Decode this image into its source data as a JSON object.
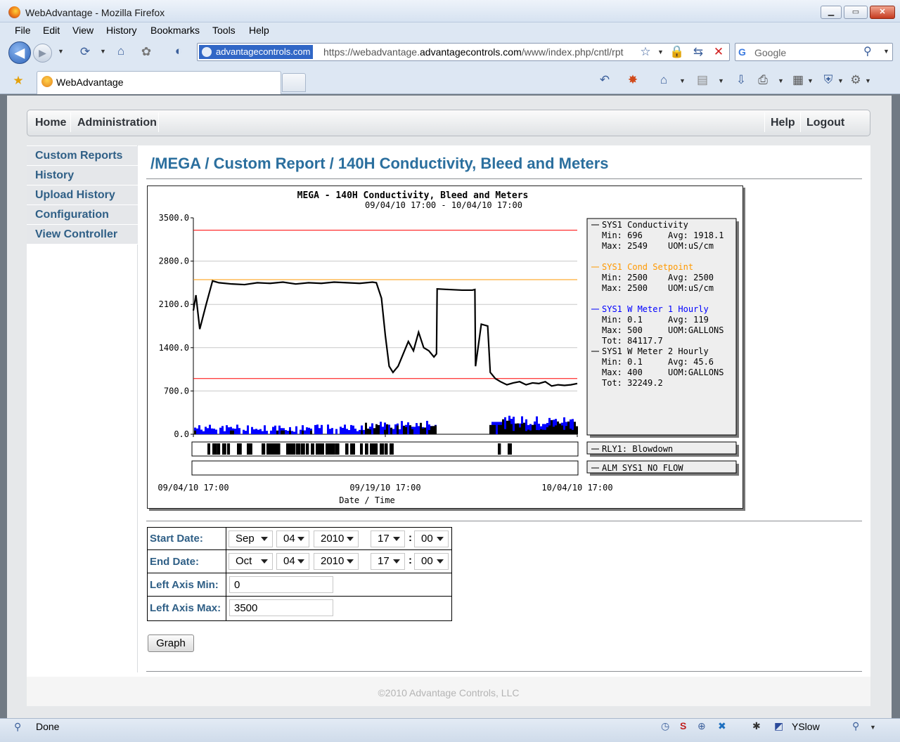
{
  "browser": {
    "title": "WebAdvantage - Mozilla Firefox",
    "menu": [
      "File",
      "Edit",
      "View",
      "History",
      "Bookmarks",
      "Tools",
      "Help"
    ],
    "url_site": "advantagecontrols.com",
    "url_prefix": "https://webadvantage.",
    "url_domain": "advantagecontrols.com",
    "url_path": "/www/index.php/cntl/rpt",
    "search_placeholder": "Google",
    "tab_label": "WebAdvantage",
    "status": "Done",
    "yslow": "YSlow"
  },
  "topnav": {
    "home": "Home",
    "admin": "Administration",
    "help": "Help",
    "logout": "Logout"
  },
  "sidebar": [
    "Custom Reports",
    "History",
    "Upload History",
    "Configuration",
    "View Controller"
  ],
  "page_title": "/MEGA / Custom Report / 140H Conductivity, Bleed and Meters",
  "chart_data": {
    "type": "line",
    "title": "MEGA - 140H Conductivity, Bleed and Meters",
    "subtitle": "09/04/10 17:00 - 10/04/10 17:00",
    "xlabel": "Date / Time",
    "x_ticks": [
      "09/04/10 17:00",
      "09/19/10 17:00",
      "10/04/10 17:00"
    ],
    "ylim": [
      0,
      3500
    ],
    "y_ticks": [
      "3500.0",
      "2800.0",
      "2100.0",
      "1400.0",
      "700.0",
      "0.0"
    ],
    "limit_lines": [
      3300,
      900
    ],
    "grid": true,
    "legend_position": "right",
    "series": [
      {
        "name": "SYS1 Conductivity",
        "color": "#000000",
        "x": [
          0,
          0.2,
          0.5,
          1,
          1.5,
          2,
          3,
          4,
          5,
          6,
          7,
          8,
          9,
          10,
          11,
          12,
          13,
          14,
          14.3,
          14.7,
          15,
          15.3,
          15.6,
          16,
          16.4,
          16.8,
          17.2,
          17.6,
          18,
          18.4,
          18.8,
          19,
          19.05,
          20,
          21,
          21.8,
          22,
          22.05,
          22.5,
          23,
          23.2,
          23.6,
          24,
          24.5,
          25,
          25.5,
          26,
          26.5,
          27,
          27.5,
          28,
          28.5,
          29,
          29.5,
          30
        ],
        "y": [
          2000,
          2250,
          1700,
          2100,
          2480,
          2450,
          2430,
          2420,
          2450,
          2440,
          2460,
          2430,
          2450,
          2440,
          2460,
          2450,
          2440,
          2460,
          2450,
          2200,
          1600,
          1100,
          1000,
          1100,
          1300,
          1500,
          1350,
          1650,
          1400,
          1350,
          1250,
          1300,
          2350,
          2340,
          2330,
          2330,
          2340,
          1100,
          1780,
          1750,
          1000,
          900,
          850,
          800,
          830,
          850,
          800,
          830,
          820,
          850,
          780,
          800,
          790,
          800,
          820
        ]
      },
      {
        "name": "SYS1 Cond Setpoint",
        "color": "#ff9900",
        "x": [
          0,
          30
        ],
        "y": [
          2500,
          2500
        ]
      },
      {
        "name": "SYS1 W Meter 1 Hourly",
        "color": "#0000ff",
        "x": [
          0,
          30
        ],
        "y": [
          100,
          100
        ]
      },
      {
        "name": "SYS1 W Meter 2 Hourly",
        "color": "#000000",
        "x": [
          0,
          30
        ],
        "y": [
          45,
          45
        ]
      }
    ],
    "legend": [
      {
        "name": "SYS1 Conductivity",
        "color": "#000000",
        "min": "Min: 696",
        "avg": "Avg: 1918.1",
        "max": "Max: 2549",
        "uom": "UOM:uS/cm",
        "tot": ""
      },
      {
        "name": "SYS1 Cond Setpoint",
        "color": "#ff9900",
        "min": "Min: 2500",
        "avg": "Avg: 2500",
        "max": "Max: 2500",
        "uom": "UOM:uS/cm",
        "tot": ""
      },
      {
        "name": "SYS1 W Meter 1 Hourly",
        "color": "#0000ff",
        "min": "Min: 0.1",
        "avg": "Avg: 119",
        "max": "Max: 500",
        "uom": "UOM:GALLONS",
        "tot": "Tot: 84117.7"
      },
      {
        "name": "SYS1 W Meter 2 Hourly",
        "color": "#000000",
        "min": "Min: 0.1",
        "avg": "Avg: 45.6",
        "max": "Max: 400",
        "uom": "UOM:GALLONS",
        "tot": "Tot: 32249.2"
      }
    ],
    "relay_label": "RLY1: Blowdown",
    "alarm_label": "ALM SYS1 NO FLOW"
  },
  "form": {
    "start_label": "Start Date:",
    "end_label": "End Date:",
    "min_label": "Left Axis Min:",
    "max_label": "Left Axis Max:",
    "start": {
      "month": "Sep",
      "day": "04",
      "year": "2010",
      "hour": "17",
      "minute": "00"
    },
    "end": {
      "month": "Oct",
      "day": "04",
      "year": "2010",
      "hour": "17",
      "minute": "00"
    },
    "axis_min": "0",
    "axis_max": "3500",
    "colon": ":",
    "graph_button": "Graph"
  },
  "footer": "©2010 Advantage Controls, LLC"
}
